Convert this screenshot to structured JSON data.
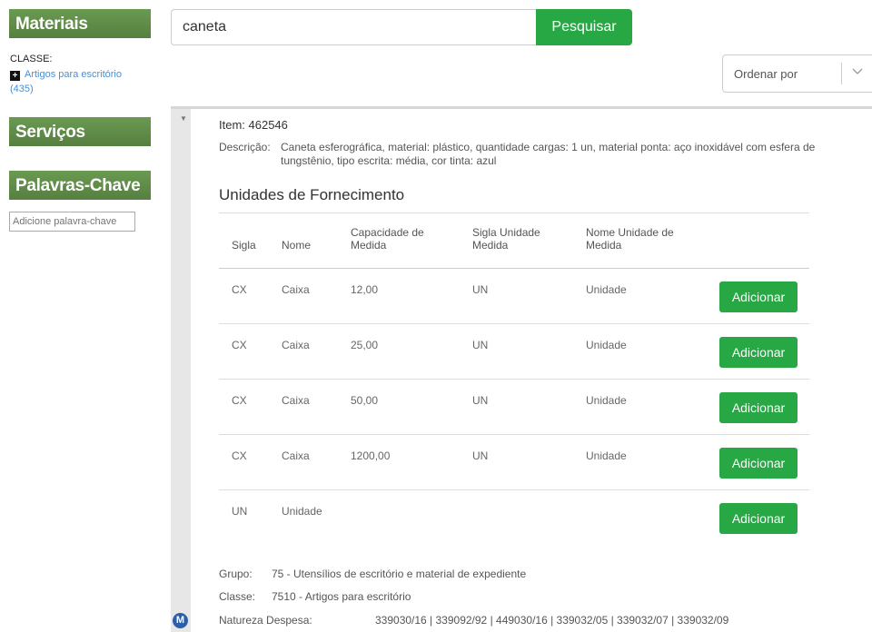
{
  "sidebar": {
    "materiais_title": "Materiais",
    "classe_label": "CLASSE:",
    "classe_plus": "+",
    "classe_link": "Artigos para escritório",
    "classe_count": "(435)",
    "servicos_title": "Serviços",
    "palavras_title": "Palavras-Chave",
    "keyword_placeholder": "Adicione palavra-chave"
  },
  "search": {
    "value": "caneta",
    "button_label": "Pesquisar"
  },
  "order": {
    "label": "Ordenar por"
  },
  "item": {
    "title": "Item: 462546",
    "desc_label": "Descrição:",
    "description": "Caneta esferográfica, material: plástico, quantidade cargas: 1 un, material ponta: aço inoxidável com esfera de tungstênio, tipo escrita: média, cor tinta: azul",
    "section_title": "Unidades de Fornecimento",
    "columns": [
      "Sigla",
      "Nome",
      "Capacidade de Medida",
      "Sigla Unidade Medida",
      "Nome Unidade de Medida"
    ],
    "rows": [
      {
        "sigla": "CX",
        "nome": "Caixa",
        "capacidade": "12,00",
        "sigla_unidade": "UN",
        "nome_unidade": "Unidade"
      },
      {
        "sigla": "CX",
        "nome": "Caixa",
        "capacidade": "25,00",
        "sigla_unidade": "UN",
        "nome_unidade": "Unidade"
      },
      {
        "sigla": "CX",
        "nome": "Caixa",
        "capacidade": "50,00",
        "sigla_unidade": "UN",
        "nome_unidade": "Unidade"
      },
      {
        "sigla": "CX",
        "nome": "Caixa",
        "capacidade": "1200,00",
        "sigla_unidade": "UN",
        "nome_unidade": "Unidade"
      },
      {
        "sigla": "UN",
        "nome": "Unidade",
        "capacidade": "",
        "sigla_unidade": "",
        "nome_unidade": ""
      }
    ],
    "add_label": "Adicionar",
    "grupo_label": "Grupo:",
    "grupo_value": "75 - Utensílios de escritório e material de expediente",
    "classe_label": "Classe:",
    "classe_value": "7510 - Artigos para escritório",
    "natureza_label": "Natureza Despesa:",
    "natureza_value": "339030/16 | 339092/92 | 449030/16 | 339032/05 | 339032/07 | 339032/09"
  },
  "badge": "M",
  "colors": {
    "sidebar_header": "#5f8e48",
    "button_green": "#28a745",
    "link_blue": "#4a8fd2"
  }
}
